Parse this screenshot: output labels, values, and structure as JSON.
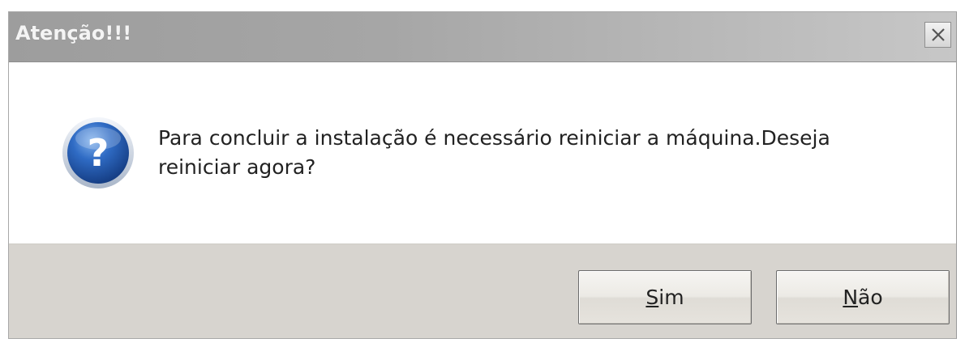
{
  "dialog": {
    "title": "Atenção!!!",
    "message_line1": "Para concluir a instalação é necessário reiniciar a máquina.Deseja",
    "message_line2": "reiniciar agora?",
    "icon": "question-icon",
    "close_icon": "close-icon"
  },
  "buttons": {
    "yes_accel": "S",
    "yes_rest": "im",
    "no_accel": "N",
    "no_rest": "ão"
  },
  "colors": {
    "titlebar": "#a6a6a6",
    "footer": "#d7d4cf",
    "icon_blue": "#2a5fb0"
  }
}
